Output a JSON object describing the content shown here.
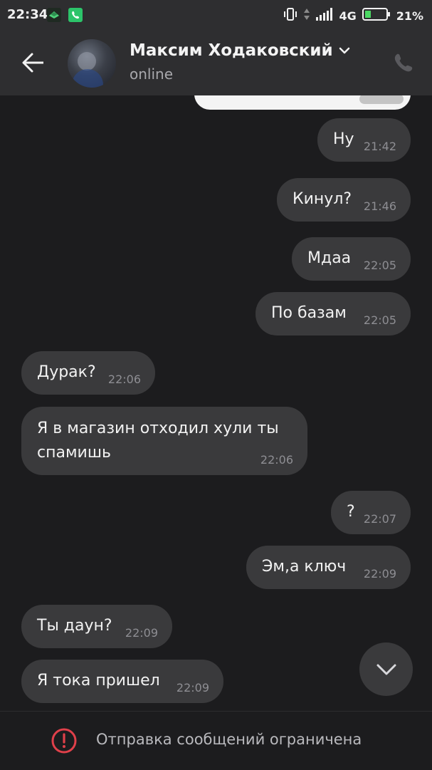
{
  "status_bar": {
    "time": "22:34",
    "network": "4G",
    "battery": "21%",
    "icons": [
      "app-icon",
      "whatsapp-icon",
      "vibrate-icon",
      "data-arrows-icon",
      "signal-icon",
      "battery-icon"
    ]
  },
  "header": {
    "contact_name": "Максим Ходаковский",
    "contact_status": "online",
    "icons": [
      "back-arrow-icon",
      "chevron-down-icon",
      "phone-icon"
    ]
  },
  "messages": [
    {
      "id": "m1",
      "direction": "outgoing",
      "text": "Ну",
      "time": "21:42"
    },
    {
      "id": "m2",
      "direction": "outgoing",
      "text": "Кинул?",
      "time": "21:46"
    },
    {
      "id": "m3",
      "direction": "outgoing",
      "text": "Мдаа",
      "time": "22:05"
    },
    {
      "id": "m4",
      "direction": "outgoing",
      "text": "По базам",
      "time": "22:05"
    },
    {
      "id": "m5",
      "direction": "incoming",
      "text": "Дурак?",
      "time": "22:06"
    },
    {
      "id": "m6",
      "direction": "incoming",
      "text_line1": "Я в магазин отходил хули ты",
      "text_line2": "спамишь",
      "time": "22:06"
    },
    {
      "id": "m7",
      "direction": "outgoing",
      "text": "?",
      "time": "22:07"
    },
    {
      "id": "m8",
      "direction": "outgoing",
      "text": "Эм,а ключ",
      "time": "22:09"
    },
    {
      "id": "m9",
      "direction": "incoming",
      "text": "Ты даун?",
      "time": "22:09"
    },
    {
      "id": "m10",
      "direction": "incoming",
      "text": "Я тока пришел",
      "time": "22:09"
    }
  ],
  "composer": {
    "restriction_text": "Отправка сообщений ограничена",
    "icon": "alert-circle-icon"
  },
  "colors": {
    "background": "#1c1c1e",
    "header": "#2e2e30",
    "bubble": "#3a3a3c",
    "alert": "#e0404a"
  }
}
